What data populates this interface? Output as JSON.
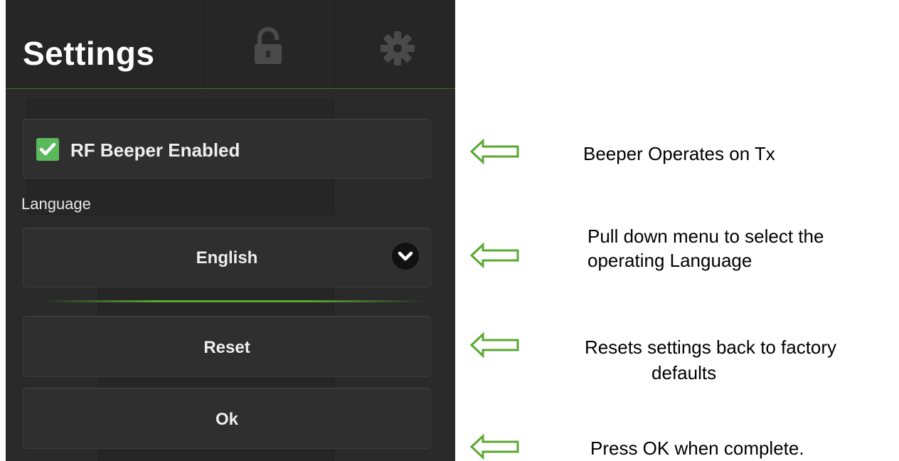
{
  "header": {
    "title": "Settings",
    "lock_icon": "lock-icon",
    "gear_icon": "gear-icon"
  },
  "beeper": {
    "label": "RF Beeper Enabled",
    "checked": true
  },
  "language": {
    "label": "Language",
    "selected": "English"
  },
  "buttons": {
    "reset": "Reset",
    "ok": "Ok"
  },
  "annotations": {
    "beeper": "Beeper Operates on Tx",
    "language_line1": "Pull down menu to select the",
    "language_line2": "operating Language",
    "reset_line1": "Resets settings back to factory",
    "reset_line2": "defaults",
    "ok": "Press OK when complete."
  },
  "colors": {
    "panel_bg": "#2a2a2a",
    "card_bg": "#2f2f2f",
    "checkbox_green": "#5cb85c",
    "arrow_green": "#5aa832",
    "divider_green": "#5aa832"
  }
}
